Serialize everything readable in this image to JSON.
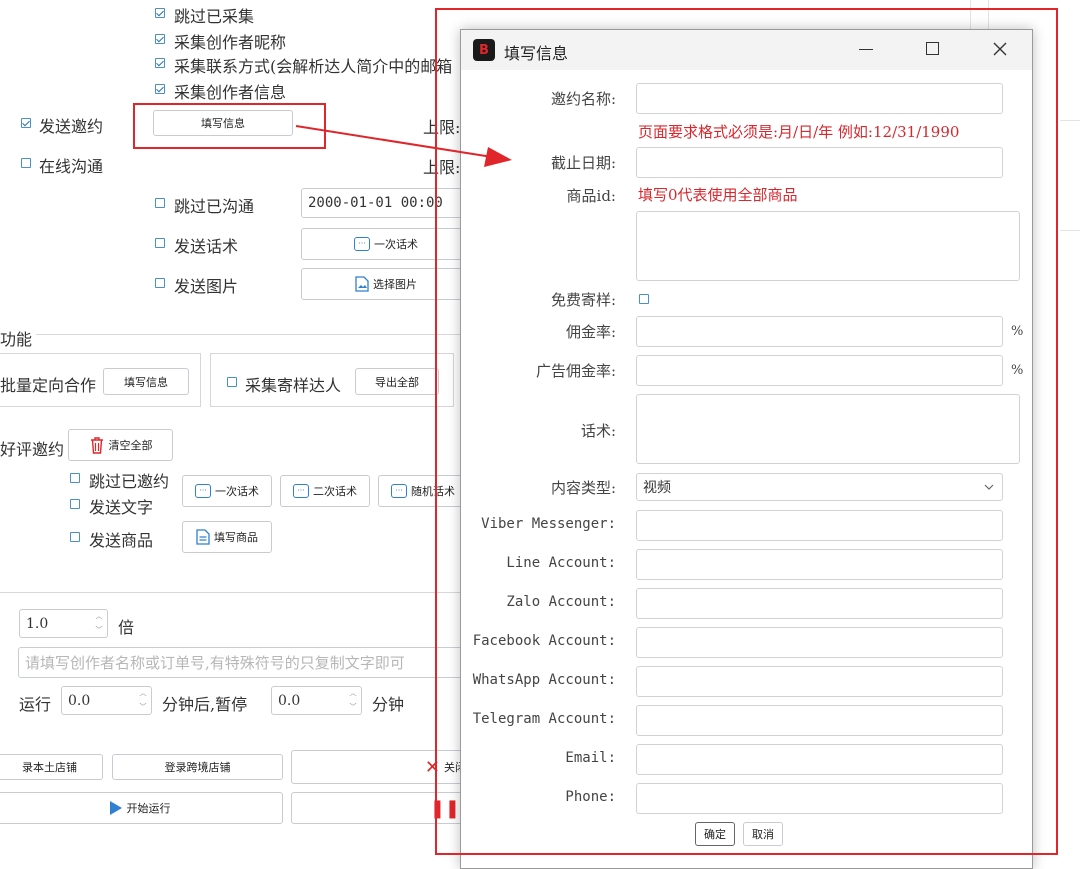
{
  "background": {
    "options": {
      "skip_collected": "跳过已采集",
      "collect_nickname": "采集创作者昵称",
      "collect_contact": "采集联系方式(会解析达人简介中的邮箱",
      "collect_info": "采集创作者信息"
    },
    "send_invite": {
      "label": "发送邀约",
      "button": "填写信息",
      "limit": "上限:"
    },
    "online_chat": {
      "label": "在线沟通",
      "limit": "上限:"
    },
    "skip_contacted": {
      "label": "跳过已沟通",
      "datetime": "2000-01-01 00:00"
    },
    "send_script": {
      "label": "发送话术",
      "button": "一次话术"
    },
    "send_image": {
      "label": "发送图片",
      "button": "选择图片"
    },
    "section_title": "功能",
    "batch_coop": {
      "label": "批量定向合作",
      "button": "填写信息"
    },
    "sample_collect": {
      "label": "采集寄样达人",
      "button": "导出全部"
    },
    "review_invite": {
      "label": "好评邀约",
      "clear_button": "清空全部"
    },
    "review_options": {
      "skip_invited": "跳过已邀约",
      "send_text": "发送文字",
      "send_product": "发送商品"
    },
    "script_buttons": {
      "first": "一次话术",
      "second": "二次话术",
      "random": "随机话术"
    },
    "fill_product": "填写商品",
    "multiplier": {
      "value": "1.0",
      "unit": "倍"
    },
    "search_placeholder": "请填写创作者名称或订单号,有特殊符号的只复制文字即可",
    "run": {
      "label": "运行",
      "value1": "0.0",
      "mid": "分钟后,暂停",
      "value2": "0.0",
      "unit": "分钟"
    },
    "bottom_buttons": {
      "login_local": "录本土店铺",
      "login_cross": "登录跨境店铺",
      "close": "关闭",
      "start": "开始运行"
    }
  },
  "dialog": {
    "title": "填写信息",
    "app_badge": "B",
    "fields": {
      "invite_name": "邀约名称:",
      "date_note": "页面要求格式必须是:月/日/年 例如:12/31/1990",
      "deadline": "截止日期:",
      "product_id": "商品id:",
      "product_note": "填写0代表使用全部商品",
      "free_sample": "免费寄样:",
      "commission": "佣金率:",
      "ad_commission": "广告佣金率:",
      "percent": "%",
      "script": "话术:",
      "content_type": "内容类型:",
      "content_type_value": "视频",
      "viber": "Viber Messenger:",
      "line": "Line Account:",
      "zalo": "Zalo Account:",
      "facebook": "Facebook Account:",
      "whatsapp": "WhatsApp Account:",
      "telegram": "Telegram Account:",
      "email": "Email:",
      "phone": "Phone:"
    },
    "ok": "确定",
    "cancel": "取消"
  },
  "colors": {
    "annotation_red": "#e0262a",
    "accent_blue": "#2f80d1"
  }
}
